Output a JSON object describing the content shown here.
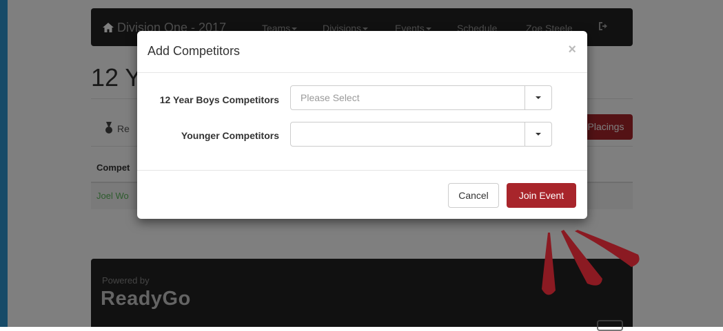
{
  "navbar": {
    "brand": "Division One - 2017",
    "items": [
      {
        "label": "Teams",
        "dropdown": true
      },
      {
        "label": "Divisions",
        "dropdown": true
      },
      {
        "label": "Events",
        "dropdown": true
      },
      {
        "label": "Schedule",
        "dropdown": false
      },
      {
        "label": "Zoe Steele",
        "dropdown": false
      }
    ],
    "logout_icon": "sign-out-icon",
    "home_icon": "home-icon"
  },
  "page": {
    "title": "12 Y",
    "results_tab": "Re",
    "placings_button": "Placings",
    "table_header": "Compet",
    "competitor_link": "Joel Wo"
  },
  "footer": {
    "powered_by": "Powered by",
    "logo": "ReadyGo"
  },
  "modal": {
    "title": "Add Competitors",
    "close": "×",
    "fields": [
      {
        "label": "12 Year Boys Competitors",
        "placeholder": "Please Select",
        "value": ""
      },
      {
        "label": "Younger Competitors",
        "placeholder": "",
        "value": ""
      }
    ],
    "cancel": "Cancel",
    "join": "Join Event"
  },
  "colors": {
    "accent": "#a8252b",
    "navbar": "#222222",
    "link_green": "#5cb85c",
    "annotation": "#8b1a22"
  }
}
